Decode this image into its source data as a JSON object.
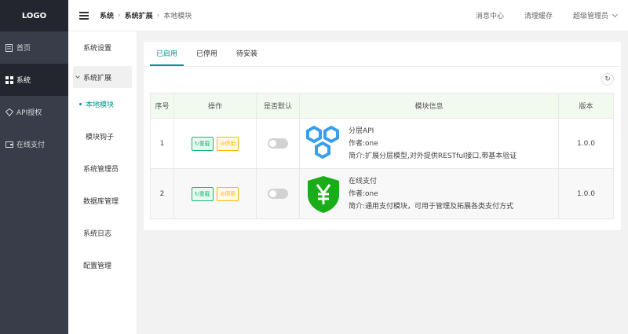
{
  "logo": "LOGO",
  "sidebar": {
    "items": [
      {
        "label": "首页",
        "icon": "file-icon"
      },
      {
        "label": "系统",
        "icon": "grid-icon"
      },
      {
        "label": "API授权",
        "icon": "diamond-icon"
      },
      {
        "label": "在线支付",
        "icon": "wallet-icon"
      }
    ]
  },
  "header": {
    "breadcrumb": [
      "系统",
      "系统扩展",
      "本地模块"
    ],
    "links": [
      "消息中心",
      "清理缓存"
    ],
    "user": "超级管理员"
  },
  "subnav": {
    "items": [
      "系统设置",
      "系统扩展",
      "本地模块",
      "模块钩子",
      "系统管理员",
      "数据库管理",
      "系统日志",
      "配置管理"
    ]
  },
  "tabs": [
    "已启用",
    "已停用",
    "待安装"
  ],
  "table": {
    "headers": [
      "序号",
      "操作",
      "是否默认",
      "模块信息",
      "版本"
    ],
    "reload_label": "重载",
    "stop_label": "停用",
    "rows": [
      {
        "no": "1",
        "name": "分层API",
        "author": "作者:one",
        "desc": "简介:扩展分层模型,对外提供RESTful接口,带基本验证",
        "version": "1.0.0",
        "default": false
      },
      {
        "no": "2",
        "name": "在线支付",
        "author": "作者:one",
        "desc": "简介:通用支付模块，可用于管理及拓展各类支付方式",
        "version": "1.0.0",
        "default": false
      }
    ]
  },
  "colors": {
    "accent": "#009688",
    "sidebar_bg": "#393d49",
    "reload": "#16b777",
    "stop": "#ffb800"
  }
}
